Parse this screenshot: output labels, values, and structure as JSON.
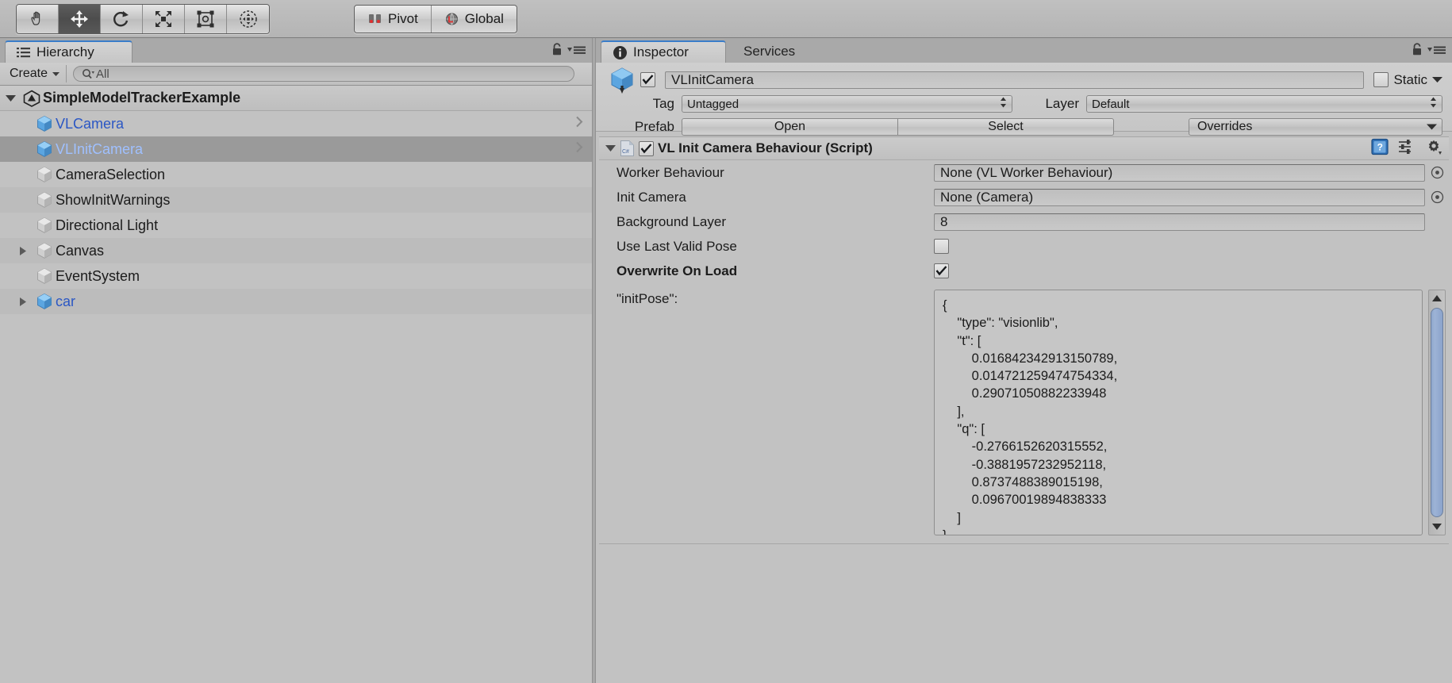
{
  "toolbar": {
    "tools": [
      {
        "name": "hand-tool",
        "active": false
      },
      {
        "name": "move-tool",
        "active": true
      },
      {
        "name": "rotate-tool",
        "active": false
      },
      {
        "name": "scale-tool",
        "active": false
      },
      {
        "name": "rect-tool",
        "active": false
      },
      {
        "name": "transform-tool",
        "active": false
      }
    ],
    "pivot_label": "Pivot",
    "global_label": "Global"
  },
  "hierarchy": {
    "tab_label": "Hierarchy",
    "create_label": "Create",
    "search_placeholder": "All",
    "search_value": "All",
    "scene_name": "SimpleModelTrackerExample",
    "items": [
      {
        "label": "VLCamera",
        "indent": 1,
        "prefab": true,
        "foldout": "none",
        "selected": false,
        "chevron": true
      },
      {
        "label": "VLInitCamera",
        "indent": 1,
        "prefab": true,
        "foldout": "none",
        "selected": true,
        "chevron": true
      },
      {
        "label": "CameraSelection",
        "indent": 1,
        "prefab": false,
        "foldout": "none",
        "selected": false,
        "chevron": false
      },
      {
        "label": "ShowInitWarnings",
        "indent": 1,
        "prefab": false,
        "foldout": "none",
        "selected": false,
        "chevron": false
      },
      {
        "label": "Directional Light",
        "indent": 1,
        "prefab": false,
        "foldout": "none",
        "selected": false,
        "chevron": false
      },
      {
        "label": "Canvas",
        "indent": 1,
        "prefab": false,
        "foldout": "collapsed",
        "selected": false,
        "chevron": false
      },
      {
        "label": "EventSystem",
        "indent": 1,
        "prefab": false,
        "foldout": "none",
        "selected": false,
        "chevron": false
      },
      {
        "label": "car",
        "indent": 1,
        "prefab": true,
        "foldout": "collapsed",
        "selected": false,
        "chevron": false
      }
    ]
  },
  "inspector": {
    "tab_label": "Inspector",
    "services_tab_label": "Services",
    "object_enabled": true,
    "object_name": "VLInitCamera",
    "static_label": "Static",
    "static_checked": false,
    "tag_label": "Tag",
    "tag_value": "Untagged",
    "layer_label": "Layer",
    "layer_value": "Default",
    "prefab_label": "Prefab",
    "prefab_open_label": "Open",
    "prefab_select_label": "Select",
    "prefab_overrides_label": "Overrides",
    "component": {
      "title": "VL Init Camera Behaviour (Script)",
      "script_badge": "C#",
      "enabled": true,
      "expanded": true,
      "properties": [
        {
          "label": "Worker Behaviour",
          "type": "object",
          "value": "None (VL Worker Behaviour)",
          "bold": false
        },
        {
          "label": "Init Camera",
          "type": "object",
          "value": "None (Camera)",
          "bold": false
        },
        {
          "label": "Background Layer",
          "type": "number",
          "value": "8",
          "bold": false
        },
        {
          "label": "Use Last Valid Pose",
          "type": "toggle",
          "value": false,
          "bold": false
        },
        {
          "label": "Overwrite On Load",
          "type": "toggle",
          "value": true,
          "bold": true
        }
      ],
      "json_field": {
        "label": "\"initPose\":",
        "text": "{\n    \"type\": \"visionlib\",\n    \"t\": [\n        0.016842342913150789,\n        0.014721259474754334,\n        0.29071050882233948\n    ],\n    \"q\": [\n        -0.2766152620315552,\n        -0.3881957232952118,\n        0.8737488389015198,\n        0.09670019894838333\n    ]\n}"
      }
    }
  },
  "colors": {
    "panel_bg": "#c2c2c2",
    "selection": "#9a9a9a",
    "prefab_blue": "#2b57c4",
    "accent_blue": "#4a8fd4",
    "scrollbar_thumb": "#93aad0"
  }
}
